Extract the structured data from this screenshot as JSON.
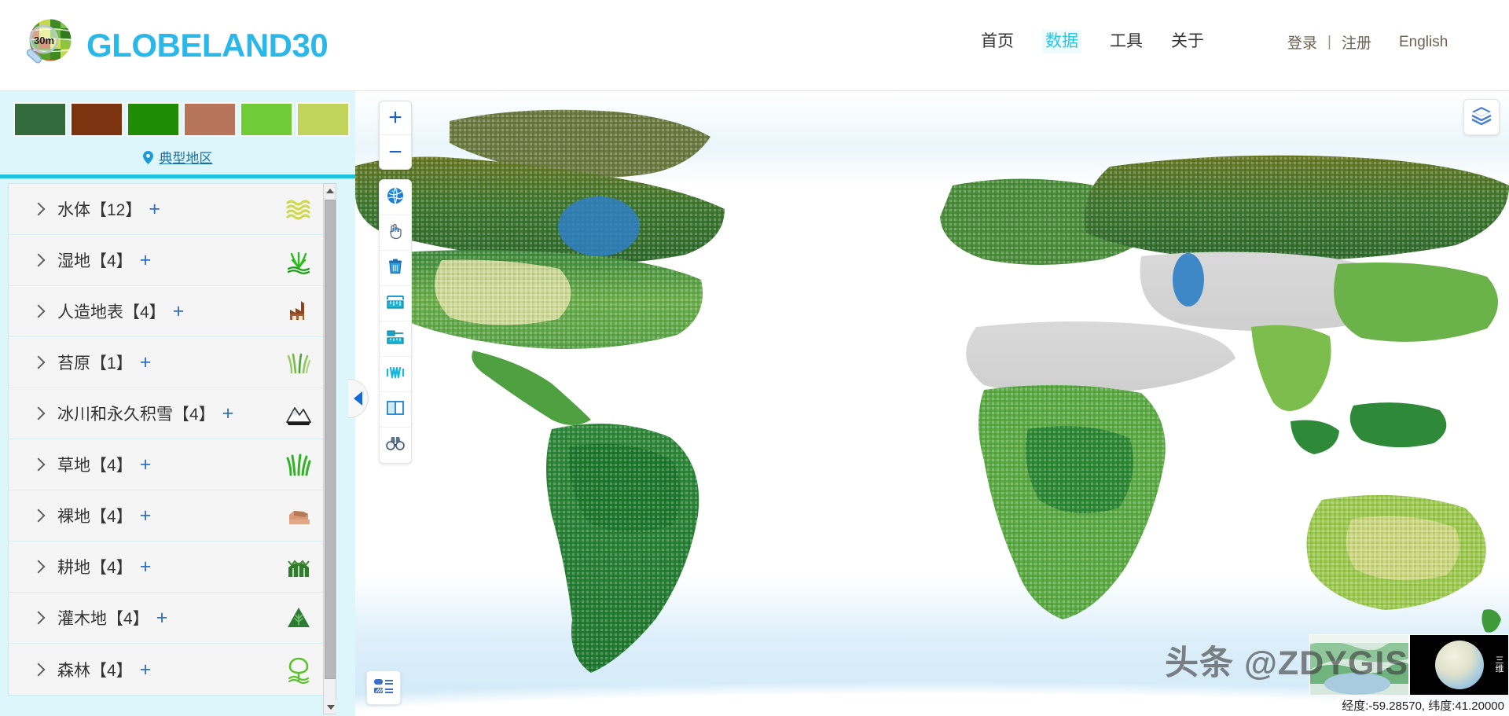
{
  "header": {
    "logo_text": "GLOBELAND30",
    "logo_badge": "30m",
    "nav": [
      {
        "label": "首页",
        "active": false
      },
      {
        "label": "数据",
        "active": true
      },
      {
        "label": "工具",
        "active": false
      },
      {
        "label": "关于",
        "active": false
      }
    ],
    "login_label": "登录",
    "separator": "|",
    "register_label": "注册",
    "language_label": "English",
    "accent_color": "#2ab8e8",
    "active_nav_color": "#26c6e8"
  },
  "sidebar": {
    "swatches": [
      {
        "name": "forest-dark-green",
        "color": "#336b3f"
      },
      {
        "name": "artificial-rust-brown",
        "color": "#7c3310"
      },
      {
        "name": "cultivated-bright-green",
        "color": "#1f8c07"
      },
      {
        "name": "bareland-salmon",
        "color": "#b6755a"
      },
      {
        "name": "grass-light-green",
        "color": "#6fcb36"
      },
      {
        "name": "shrub-yellow-green",
        "color": "#c0d45c"
      }
    ],
    "typical_region_label": "典型地区",
    "typical_region_icon": "location-pin-icon",
    "divider_color": "#1fc5e0",
    "categories": [
      {
        "label": "水体【12】",
        "plus": "+",
        "icon": "water-waves-icon",
        "count": 12
      },
      {
        "label": "湿地【4】",
        "plus": "+",
        "icon": "wetland-reed-icon",
        "count": 4
      },
      {
        "label": "人造地表【4】",
        "plus": "+",
        "icon": "factory-building-icon",
        "count": 4
      },
      {
        "label": "苔原【1】",
        "plus": "+",
        "icon": "tundra-grass-icon",
        "count": 1
      },
      {
        "label": "冰川和永久积雪【4】",
        "plus": "+",
        "icon": "snow-mountain-icon",
        "count": 4
      },
      {
        "label": "草地【4】",
        "plus": "+",
        "icon": "grass-blades-icon",
        "count": 4
      },
      {
        "label": "裸地【4】",
        "plus": "+",
        "icon": "bare-soil-icon",
        "count": 4
      },
      {
        "label": "耕地【4】",
        "plus": "+",
        "icon": "cropland-field-icon",
        "count": 4
      },
      {
        "label": "灌木地【4】",
        "plus": "+",
        "icon": "shrub-tree-icon",
        "count": 4
      },
      {
        "label": "森林【4】",
        "plus": "+",
        "icon": "forest-tree-icon",
        "count": 4
      }
    ],
    "collapse_handle_icon": "chevron-left-icon"
  },
  "map": {
    "zoom_in_label": "+",
    "zoom_out_label": "−",
    "tools": [
      {
        "icon": "globe-icon",
        "name": "globe-view-tool"
      },
      {
        "icon": "hand-icon",
        "name": "pan-tool"
      },
      {
        "icon": "trash-icon",
        "name": "clear-tool"
      },
      {
        "icon": "ruler-icon",
        "name": "measure-distance-tool"
      },
      {
        "icon": "area-measure-icon",
        "name": "measure-area-tool"
      },
      {
        "icon": "profile-wave-icon",
        "name": "terrain-profile-tool"
      },
      {
        "icon": "split-view-icon",
        "name": "split-compare-tool"
      },
      {
        "icon": "binoculars-icon",
        "name": "swipe-inspect-tool"
      }
    ],
    "layers_icon": "layers-stack-icon",
    "legend_icon": "legend-list-icon",
    "thumbnails": [
      {
        "name": "map-2d-thumbnail",
        "label": ""
      },
      {
        "name": "globe-3d-thumbnail",
        "label": "三维"
      }
    ],
    "coordinates": "经度:-59.28570, 纬度:41.20000",
    "watermark": "头条 @ZDYGIS"
  }
}
